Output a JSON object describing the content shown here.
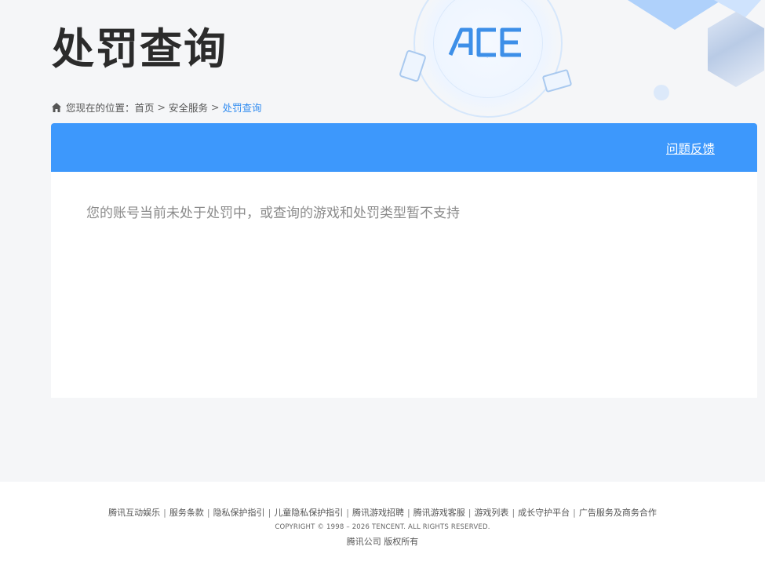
{
  "header": {
    "title": "处罚查询",
    "logo_text": "ACE"
  },
  "breadcrumb": {
    "prefix": "您现在的位置：",
    "items": [
      "首页",
      "安全服务"
    ],
    "current": "处罚查询",
    "separator": ">"
  },
  "panel": {
    "feedback_label": "问题反馈",
    "message": "您的账号当前未处于处罚中，或查询的游戏和处罚类型暂不支持"
  },
  "footer": {
    "links": [
      "腾讯互动娱乐",
      "服务条款",
      "隐私保护指引",
      "儿童隐私保护指引",
      "腾讯游戏招聘",
      "腾讯游戏客服",
      "游戏列表",
      "成长守护平台",
      "广告服务及商务合作"
    ],
    "copyright": "COPYRIGHT © 1998 – 2026 TENCENT. ALL RIGHTS RESERVED.",
    "company": "腾讯公司 版权所有"
  },
  "colors": {
    "accent": "#3d98fc",
    "breadcrumb_current": "#2f8bf0",
    "background": "#f5f6f8"
  },
  "icons": {
    "home": "home-icon"
  }
}
